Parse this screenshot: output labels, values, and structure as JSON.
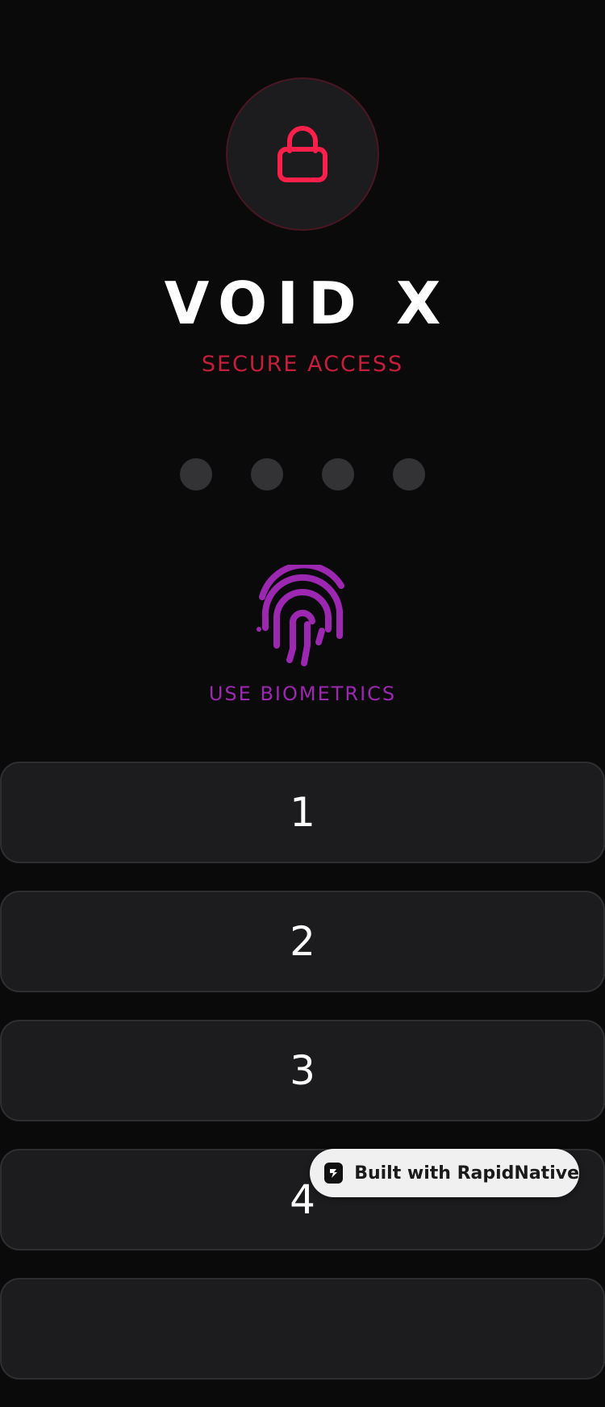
{
  "app": {
    "title": "VOID X",
    "subtitle": "SECURE ACCESS"
  },
  "lock": {
    "icon": "lock-icon",
    "accent_color": "#ff1f4b"
  },
  "pin": {
    "length": 4,
    "entered": 0
  },
  "biometrics": {
    "icon": "fingerprint-icon",
    "label": "USE BIOMETRICS",
    "color": "#9c27b0"
  },
  "keypad": {
    "keys": [
      "1",
      "2",
      "3",
      "4",
      ""
    ]
  },
  "badge": {
    "label": "Built with RapidNative"
  }
}
